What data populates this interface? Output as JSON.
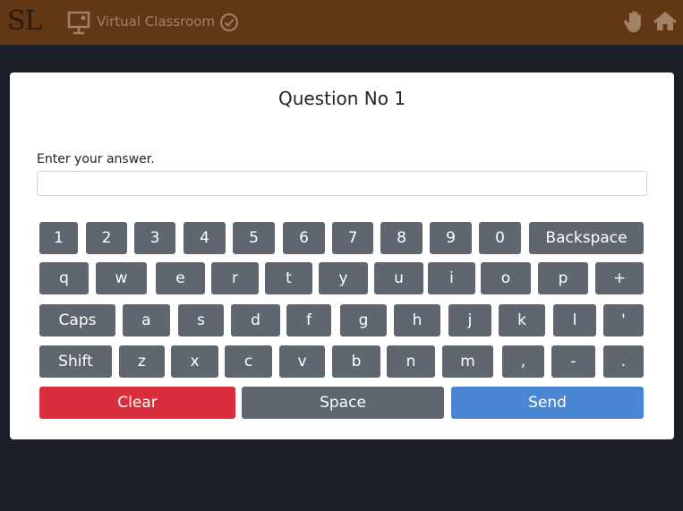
{
  "header": {
    "logo_text": "SL",
    "app_title": "Virtual Classroom",
    "icons": [
      "presentation-icon",
      "check-circle-icon",
      "raise-hand-icon",
      "home-icon"
    ],
    "colors": {
      "bar": "#623714",
      "title": "#a08266"
    }
  },
  "question": {
    "title": "Question No 1",
    "prompt": "Enter your answer.",
    "answer_value": "",
    "answer_placeholder": ""
  },
  "keyboard": {
    "row1": [
      "1",
      "2",
      "3",
      "4",
      "5",
      "6",
      "7",
      "8",
      "9",
      "0",
      "Backspace"
    ],
    "row2": [
      "q",
      "w",
      "e",
      "r",
      "t",
      "y",
      "u",
      "i",
      "o",
      "p",
      "+"
    ],
    "row3": [
      "Caps",
      "a",
      "s",
      "d",
      "f",
      "g",
      "h",
      "j",
      "k",
      "l",
      "'"
    ],
    "row4": [
      "Shift",
      "z",
      "x",
      "c",
      "v",
      "b",
      "n",
      "m",
      ",",
      "-",
      "."
    ],
    "actions": {
      "clear": "Clear",
      "space": "Space",
      "send": "Send"
    },
    "colors": {
      "key": "#5f6670",
      "clear": "#d92e3b",
      "send": "#4a86d4"
    }
  }
}
